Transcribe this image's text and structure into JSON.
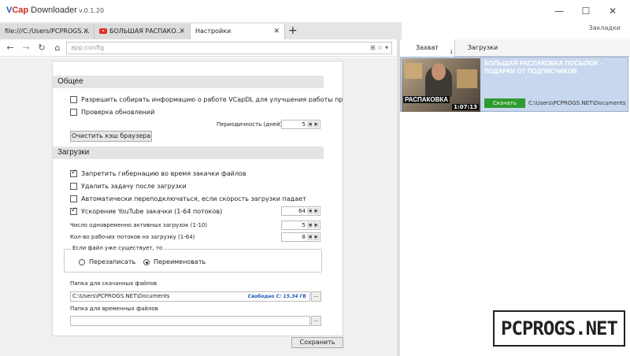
{
  "app": {
    "logo_v": "V",
    "logo_cap": "Cap",
    "logo_rest": " Downloader",
    "version": "v.0.1.20",
    "bookmarks": "Закладки"
  },
  "window_controls": {
    "minimize": "—",
    "maximize": "☐",
    "close": "✕"
  },
  "tabs": [
    {
      "label": "file:///C:/Users/PCPROGS....",
      "close": "✕"
    },
    {
      "label": "БОЛЬШАЯ РАСПАКО...",
      "close": "✕"
    },
    {
      "label": "Настройки",
      "close": "✕"
    }
  ],
  "new_tab": "+",
  "navbar": {
    "back": "←",
    "forward": "→",
    "reload": "↻",
    "home": "⌂",
    "address": "app:config",
    "addr_icons": "⊞ ☆ ▾"
  },
  "settings": {
    "general": {
      "title": "Общее",
      "allow_collect": {
        "label": "Разрешить собирать информацию о работе VCapDL для улучшения работы пр...",
        "checked": false
      },
      "check_updates": {
        "label": "Проверка обновлений",
        "checked": false
      },
      "period_label": "Периодичность (дней)",
      "period_value": "5",
      "clear_cache": "Очистить кэш браузера"
    },
    "downloads": {
      "title": "Загрузки",
      "no_hibernate": {
        "label": "Запретить гибернацию во время закачки файлов",
        "checked": true
      },
      "delete_task": {
        "label": "Удалить задачу после загрузки",
        "checked": false
      },
      "auto_switch": {
        "label": "Автоматически переподключаться, если скорость загрузки падает",
        "checked": false
      },
      "yt_accel": {
        "label": "Ускорение YouTube закачки (1-64 потоков)",
        "checked": true
      },
      "yt_accel_value": "64",
      "active_label": "Число одновременно активных загрузок (1-10)",
      "active_value": "5",
      "threads_label": "Кол-во рабочих потоков на загрузку (1-64)",
      "threads_value": "8",
      "exists_title": "Если файл уже существует, то",
      "overwrite": "Перезаписать",
      "rename": "Переименовать",
      "selected_option": "rename",
      "folder_label": "Папка для скачанных файлов",
      "folder_value": "C:\\Users\\PCPROGS.NET\\Documents",
      "free_space": "Свободно С: 15.34 ГБ",
      "temp_label": "Папка для временных файлов",
      "temp_value": "",
      "browse": "..."
    },
    "save": "Сохранить"
  },
  "right_panel": {
    "tab_capture": "Захват",
    "capture_count": "1",
    "tab_downloads": "Загрузки",
    "item": {
      "title": "БОЛЬШАЯ РАСПАКОВКА ПОСЫЛОК - ПОДАРКИ ОТ ПОДПИСЧИКОВ",
      "thumb_caption": "РАСПАКОВКА",
      "duration": "1:07:13",
      "download": "Скачать",
      "path": "C:\\Users\\PCPROGS.NET\\Documents"
    }
  },
  "watermark": "PCPROGS.NET"
}
